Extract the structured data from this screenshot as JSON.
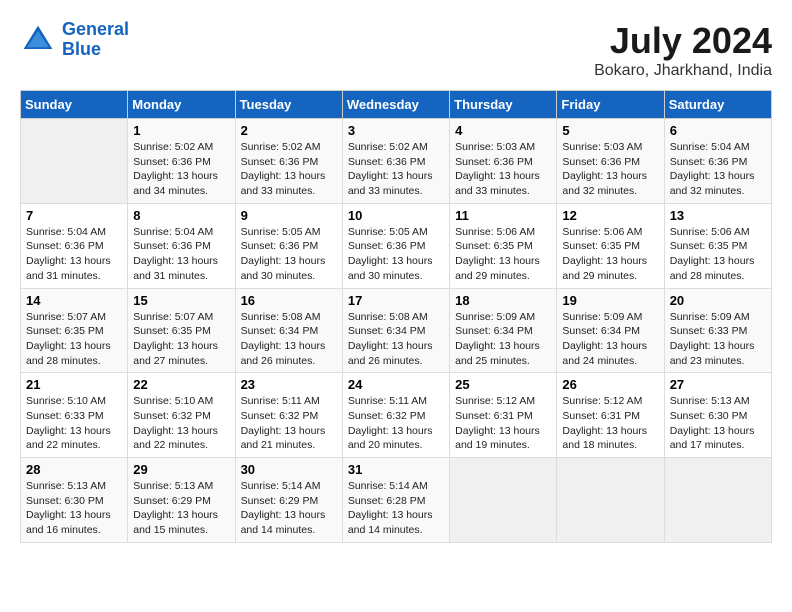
{
  "header": {
    "logo_line1": "General",
    "logo_line2": "Blue",
    "month_year": "July 2024",
    "location": "Bokaro, Jharkhand, India"
  },
  "weekdays": [
    "Sunday",
    "Monday",
    "Tuesday",
    "Wednesday",
    "Thursday",
    "Friday",
    "Saturday"
  ],
  "weeks": [
    [
      {
        "day": "",
        "sunrise": "",
        "sunset": "",
        "daylight": ""
      },
      {
        "day": "1",
        "sunrise": "Sunrise: 5:02 AM",
        "sunset": "Sunset: 6:36 PM",
        "daylight": "Daylight: 13 hours and 34 minutes."
      },
      {
        "day": "2",
        "sunrise": "Sunrise: 5:02 AM",
        "sunset": "Sunset: 6:36 PM",
        "daylight": "Daylight: 13 hours and 33 minutes."
      },
      {
        "day": "3",
        "sunrise": "Sunrise: 5:02 AM",
        "sunset": "Sunset: 6:36 PM",
        "daylight": "Daylight: 13 hours and 33 minutes."
      },
      {
        "day": "4",
        "sunrise": "Sunrise: 5:03 AM",
        "sunset": "Sunset: 6:36 PM",
        "daylight": "Daylight: 13 hours and 33 minutes."
      },
      {
        "day": "5",
        "sunrise": "Sunrise: 5:03 AM",
        "sunset": "Sunset: 6:36 PM",
        "daylight": "Daylight: 13 hours and 32 minutes."
      },
      {
        "day": "6",
        "sunrise": "Sunrise: 5:04 AM",
        "sunset": "Sunset: 6:36 PM",
        "daylight": "Daylight: 13 hours and 32 minutes."
      }
    ],
    [
      {
        "day": "7",
        "sunrise": "Sunrise: 5:04 AM",
        "sunset": "Sunset: 6:36 PM",
        "daylight": "Daylight: 13 hours and 31 minutes."
      },
      {
        "day": "8",
        "sunrise": "Sunrise: 5:04 AM",
        "sunset": "Sunset: 6:36 PM",
        "daylight": "Daylight: 13 hours and 31 minutes."
      },
      {
        "day": "9",
        "sunrise": "Sunrise: 5:05 AM",
        "sunset": "Sunset: 6:36 PM",
        "daylight": "Daylight: 13 hours and 30 minutes."
      },
      {
        "day": "10",
        "sunrise": "Sunrise: 5:05 AM",
        "sunset": "Sunset: 6:36 PM",
        "daylight": "Daylight: 13 hours and 30 minutes."
      },
      {
        "day": "11",
        "sunrise": "Sunrise: 5:06 AM",
        "sunset": "Sunset: 6:35 PM",
        "daylight": "Daylight: 13 hours and 29 minutes."
      },
      {
        "day": "12",
        "sunrise": "Sunrise: 5:06 AM",
        "sunset": "Sunset: 6:35 PM",
        "daylight": "Daylight: 13 hours and 29 minutes."
      },
      {
        "day": "13",
        "sunrise": "Sunrise: 5:06 AM",
        "sunset": "Sunset: 6:35 PM",
        "daylight": "Daylight: 13 hours and 28 minutes."
      }
    ],
    [
      {
        "day": "14",
        "sunrise": "Sunrise: 5:07 AM",
        "sunset": "Sunset: 6:35 PM",
        "daylight": "Daylight: 13 hours and 28 minutes."
      },
      {
        "day": "15",
        "sunrise": "Sunrise: 5:07 AM",
        "sunset": "Sunset: 6:35 PM",
        "daylight": "Daylight: 13 hours and 27 minutes."
      },
      {
        "day": "16",
        "sunrise": "Sunrise: 5:08 AM",
        "sunset": "Sunset: 6:34 PM",
        "daylight": "Daylight: 13 hours and 26 minutes."
      },
      {
        "day": "17",
        "sunrise": "Sunrise: 5:08 AM",
        "sunset": "Sunset: 6:34 PM",
        "daylight": "Daylight: 13 hours and 26 minutes."
      },
      {
        "day": "18",
        "sunrise": "Sunrise: 5:09 AM",
        "sunset": "Sunset: 6:34 PM",
        "daylight": "Daylight: 13 hours and 25 minutes."
      },
      {
        "day": "19",
        "sunrise": "Sunrise: 5:09 AM",
        "sunset": "Sunset: 6:34 PM",
        "daylight": "Daylight: 13 hours and 24 minutes."
      },
      {
        "day": "20",
        "sunrise": "Sunrise: 5:09 AM",
        "sunset": "Sunset: 6:33 PM",
        "daylight": "Daylight: 13 hours and 23 minutes."
      }
    ],
    [
      {
        "day": "21",
        "sunrise": "Sunrise: 5:10 AM",
        "sunset": "Sunset: 6:33 PM",
        "daylight": "Daylight: 13 hours and 22 minutes."
      },
      {
        "day": "22",
        "sunrise": "Sunrise: 5:10 AM",
        "sunset": "Sunset: 6:32 PM",
        "daylight": "Daylight: 13 hours and 22 minutes."
      },
      {
        "day": "23",
        "sunrise": "Sunrise: 5:11 AM",
        "sunset": "Sunset: 6:32 PM",
        "daylight": "Daylight: 13 hours and 21 minutes."
      },
      {
        "day": "24",
        "sunrise": "Sunrise: 5:11 AM",
        "sunset": "Sunset: 6:32 PM",
        "daylight": "Daylight: 13 hours and 20 minutes."
      },
      {
        "day": "25",
        "sunrise": "Sunrise: 5:12 AM",
        "sunset": "Sunset: 6:31 PM",
        "daylight": "Daylight: 13 hours and 19 minutes."
      },
      {
        "day": "26",
        "sunrise": "Sunrise: 5:12 AM",
        "sunset": "Sunset: 6:31 PM",
        "daylight": "Daylight: 13 hours and 18 minutes."
      },
      {
        "day": "27",
        "sunrise": "Sunrise: 5:13 AM",
        "sunset": "Sunset: 6:30 PM",
        "daylight": "Daylight: 13 hours and 17 minutes."
      }
    ],
    [
      {
        "day": "28",
        "sunrise": "Sunrise: 5:13 AM",
        "sunset": "Sunset: 6:30 PM",
        "daylight": "Daylight: 13 hours and 16 minutes."
      },
      {
        "day": "29",
        "sunrise": "Sunrise: 5:13 AM",
        "sunset": "Sunset: 6:29 PM",
        "daylight": "Daylight: 13 hours and 15 minutes."
      },
      {
        "day": "30",
        "sunrise": "Sunrise: 5:14 AM",
        "sunset": "Sunset: 6:29 PM",
        "daylight": "Daylight: 13 hours and 14 minutes."
      },
      {
        "day": "31",
        "sunrise": "Sunrise: 5:14 AM",
        "sunset": "Sunset: 6:28 PM",
        "daylight": "Daylight: 13 hours and 14 minutes."
      },
      {
        "day": "",
        "sunrise": "",
        "sunset": "",
        "daylight": ""
      },
      {
        "day": "",
        "sunrise": "",
        "sunset": "",
        "daylight": ""
      },
      {
        "day": "",
        "sunrise": "",
        "sunset": "",
        "daylight": ""
      }
    ]
  ]
}
